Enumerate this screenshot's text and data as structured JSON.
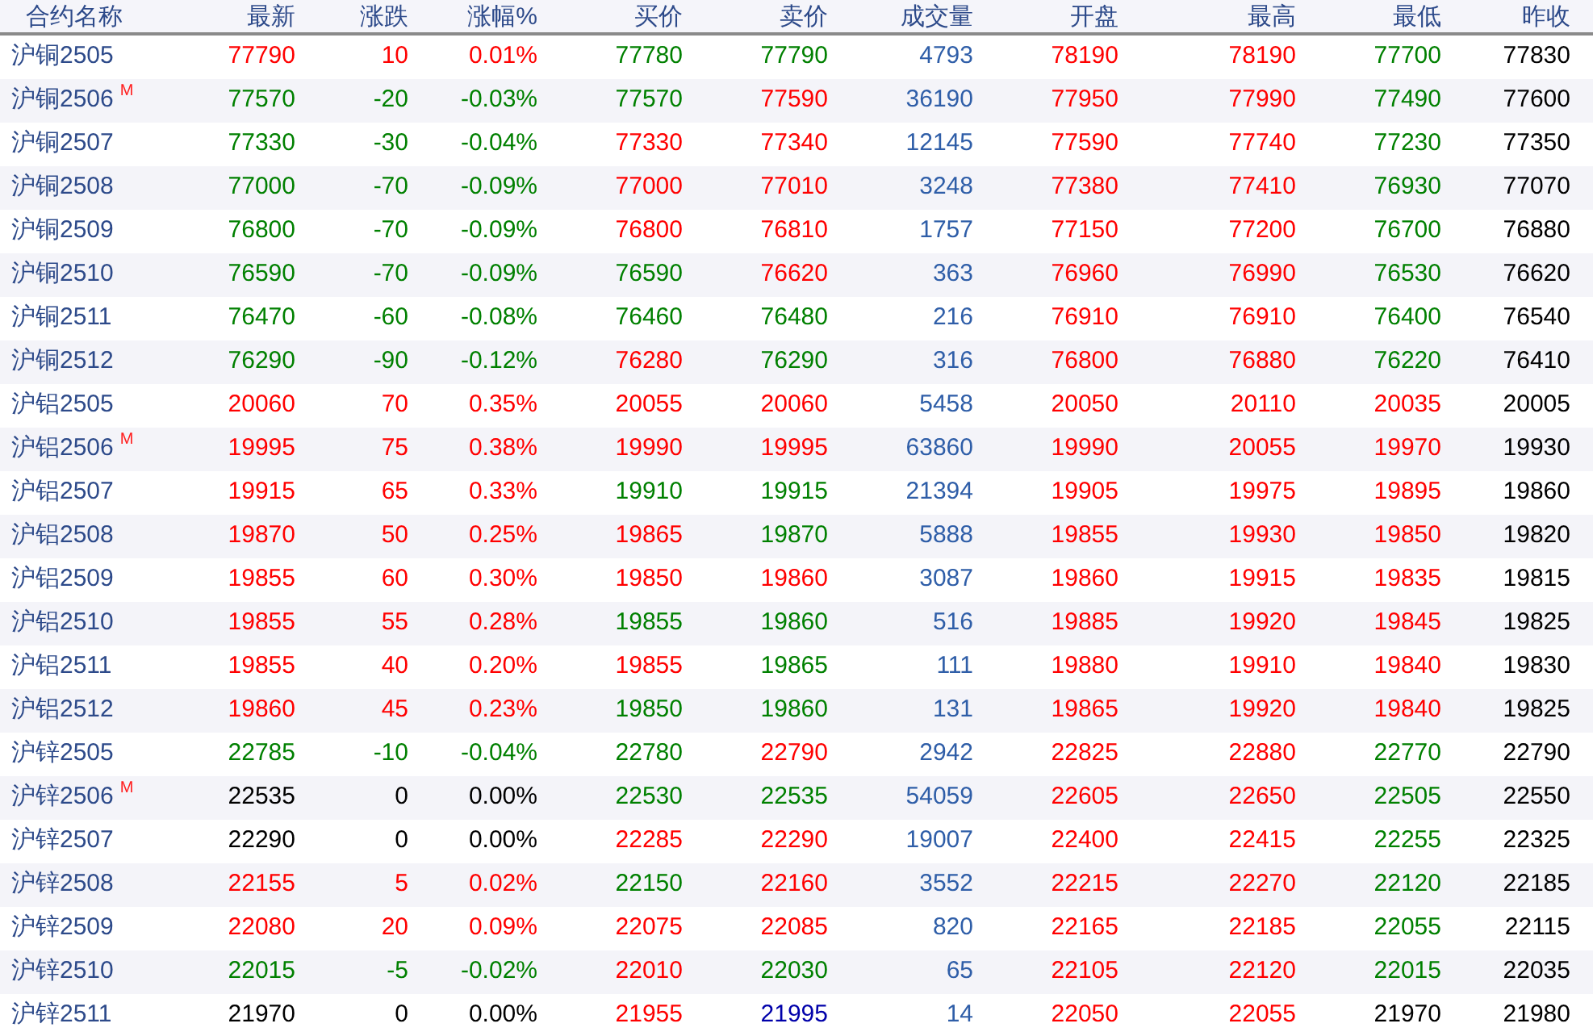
{
  "columns": [
    "合约名称",
    "最新",
    "涨跌",
    "涨幅%",
    "买价",
    "卖价",
    "成交量",
    "开盘",
    "最高",
    "最低",
    "昨收"
  ],
  "rows": [
    {
      "name": "沪铜2505",
      "cells": [
        {
          "text": "77790",
          "color": "#ff0000"
        },
        {
          "text": "10",
          "color": "#ff0000"
        },
        {
          "text": "0.01%",
          "color": "#ff0000"
        },
        {
          "text": "77780",
          "color": "#008000"
        },
        {
          "text": "77790",
          "color": "#008000"
        },
        {
          "text": "4793",
          "color": "#2f5ea8"
        },
        {
          "text": "78190",
          "color": "#ff0000"
        },
        {
          "text": "78190",
          "color": "#ff0000"
        },
        {
          "text": "77700",
          "color": "#008000"
        },
        {
          "text": "77830",
          "color": "#000000"
        }
      ]
    },
    {
      "name": "沪铜2506",
      "badge": "M",
      "cells": [
        {
          "text": "77570",
          "color": "#008000"
        },
        {
          "text": "-20",
          "color": "#008000"
        },
        {
          "text": "-0.03%",
          "color": "#008000"
        },
        {
          "text": "77570",
          "color": "#008000"
        },
        {
          "text": "77590",
          "color": "#ff0000"
        },
        {
          "text": "36190",
          "color": "#2f5ea8"
        },
        {
          "text": "77950",
          "color": "#ff0000"
        },
        {
          "text": "77990",
          "color": "#ff0000"
        },
        {
          "text": "77490",
          "color": "#008000"
        },
        {
          "text": "77600",
          "color": "#000000"
        }
      ]
    },
    {
      "name": "沪铜2507",
      "cells": [
        {
          "text": "77330",
          "color": "#008000"
        },
        {
          "text": "-30",
          "color": "#008000"
        },
        {
          "text": "-0.04%",
          "color": "#008000"
        },
        {
          "text": "77330",
          "color": "#ff0000"
        },
        {
          "text": "77340",
          "color": "#ff0000"
        },
        {
          "text": "12145",
          "color": "#2f5ea8"
        },
        {
          "text": "77590",
          "color": "#ff0000"
        },
        {
          "text": "77740",
          "color": "#ff0000"
        },
        {
          "text": "77230",
          "color": "#008000"
        },
        {
          "text": "77350",
          "color": "#000000"
        }
      ]
    },
    {
      "name": "沪铜2508",
      "cells": [
        {
          "text": "77000",
          "color": "#008000"
        },
        {
          "text": "-70",
          "color": "#008000"
        },
        {
          "text": "-0.09%",
          "color": "#008000"
        },
        {
          "text": "77000",
          "color": "#ff0000"
        },
        {
          "text": "77010",
          "color": "#ff0000"
        },
        {
          "text": "3248",
          "color": "#2f5ea8"
        },
        {
          "text": "77380",
          "color": "#ff0000"
        },
        {
          "text": "77410",
          "color": "#ff0000"
        },
        {
          "text": "76930",
          "color": "#008000"
        },
        {
          "text": "77070",
          "color": "#000000"
        }
      ]
    },
    {
      "name": "沪铜2509",
      "cells": [
        {
          "text": "76800",
          "color": "#008000"
        },
        {
          "text": "-70",
          "color": "#008000"
        },
        {
          "text": "-0.09%",
          "color": "#008000"
        },
        {
          "text": "76800",
          "color": "#ff0000"
        },
        {
          "text": "76810",
          "color": "#ff0000"
        },
        {
          "text": "1757",
          "color": "#2f5ea8"
        },
        {
          "text": "77150",
          "color": "#ff0000"
        },
        {
          "text": "77200",
          "color": "#ff0000"
        },
        {
          "text": "76700",
          "color": "#008000"
        },
        {
          "text": "76880",
          "color": "#000000"
        }
      ]
    },
    {
      "name": "沪铜2510",
      "cells": [
        {
          "text": "76590",
          "color": "#008000"
        },
        {
          "text": "-70",
          "color": "#008000"
        },
        {
          "text": "-0.09%",
          "color": "#008000"
        },
        {
          "text": "76590",
          "color": "#008000"
        },
        {
          "text": "76620",
          "color": "#ff0000"
        },
        {
          "text": "363",
          "color": "#2f5ea8"
        },
        {
          "text": "76960",
          "color": "#ff0000"
        },
        {
          "text": "76990",
          "color": "#ff0000"
        },
        {
          "text": "76530",
          "color": "#008000"
        },
        {
          "text": "76620",
          "color": "#000000"
        }
      ]
    },
    {
      "name": "沪铜2511",
      "cells": [
        {
          "text": "76470",
          "color": "#008000"
        },
        {
          "text": "-60",
          "color": "#008000"
        },
        {
          "text": "-0.08%",
          "color": "#008000"
        },
        {
          "text": "76460",
          "color": "#008000"
        },
        {
          "text": "76480",
          "color": "#008000"
        },
        {
          "text": "216",
          "color": "#2f5ea8"
        },
        {
          "text": "76910",
          "color": "#ff0000"
        },
        {
          "text": "76910",
          "color": "#ff0000"
        },
        {
          "text": "76400",
          "color": "#008000"
        },
        {
          "text": "76540",
          "color": "#000000"
        }
      ]
    },
    {
      "name": "沪铜2512",
      "cells": [
        {
          "text": "76290",
          "color": "#008000"
        },
        {
          "text": "-90",
          "color": "#008000"
        },
        {
          "text": "-0.12%",
          "color": "#008000"
        },
        {
          "text": "76280",
          "color": "#ff0000"
        },
        {
          "text": "76290",
          "color": "#008000"
        },
        {
          "text": "316",
          "color": "#2f5ea8"
        },
        {
          "text": "76800",
          "color": "#ff0000"
        },
        {
          "text": "76880",
          "color": "#ff0000"
        },
        {
          "text": "76220",
          "color": "#008000"
        },
        {
          "text": "76410",
          "color": "#000000"
        }
      ]
    },
    {
      "name": "沪铝2505",
      "cells": [
        {
          "text": "20060",
          "color": "#ff0000"
        },
        {
          "text": "70",
          "color": "#ff0000"
        },
        {
          "text": "0.35%",
          "color": "#ff0000"
        },
        {
          "text": "20055",
          "color": "#ff0000"
        },
        {
          "text": "20060",
          "color": "#ff0000"
        },
        {
          "text": "5458",
          "color": "#2f5ea8"
        },
        {
          "text": "20050",
          "color": "#ff0000"
        },
        {
          "text": "20110",
          "color": "#ff0000"
        },
        {
          "text": "20035",
          "color": "#ff0000"
        },
        {
          "text": "20005",
          "color": "#000000"
        }
      ]
    },
    {
      "name": "沪铝2506",
      "badge": "M",
      "cells": [
        {
          "text": "19995",
          "color": "#ff0000"
        },
        {
          "text": "75",
          "color": "#ff0000"
        },
        {
          "text": "0.38%",
          "color": "#ff0000"
        },
        {
          "text": "19990",
          "color": "#ff0000"
        },
        {
          "text": "19995",
          "color": "#ff0000"
        },
        {
          "text": "63860",
          "color": "#2f5ea8"
        },
        {
          "text": "19990",
          "color": "#ff0000"
        },
        {
          "text": "20055",
          "color": "#ff0000"
        },
        {
          "text": "19970",
          "color": "#ff0000"
        },
        {
          "text": "19930",
          "color": "#000000"
        }
      ]
    },
    {
      "name": "沪铝2507",
      "cells": [
        {
          "text": "19915",
          "color": "#ff0000"
        },
        {
          "text": "65",
          "color": "#ff0000"
        },
        {
          "text": "0.33%",
          "color": "#ff0000"
        },
        {
          "text": "19910",
          "color": "#008000"
        },
        {
          "text": "19915",
          "color": "#008000"
        },
        {
          "text": "21394",
          "color": "#2f5ea8"
        },
        {
          "text": "19905",
          "color": "#ff0000"
        },
        {
          "text": "19975",
          "color": "#ff0000"
        },
        {
          "text": "19895",
          "color": "#ff0000"
        },
        {
          "text": "19860",
          "color": "#000000"
        }
      ]
    },
    {
      "name": "沪铝2508",
      "cells": [
        {
          "text": "19870",
          "color": "#ff0000"
        },
        {
          "text": "50",
          "color": "#ff0000"
        },
        {
          "text": "0.25%",
          "color": "#ff0000"
        },
        {
          "text": "19865",
          "color": "#ff0000"
        },
        {
          "text": "19870",
          "color": "#008000"
        },
        {
          "text": "5888",
          "color": "#2f5ea8"
        },
        {
          "text": "19855",
          "color": "#ff0000"
        },
        {
          "text": "19930",
          "color": "#ff0000"
        },
        {
          "text": "19850",
          "color": "#ff0000"
        },
        {
          "text": "19820",
          "color": "#000000"
        }
      ]
    },
    {
      "name": "沪铝2509",
      "cells": [
        {
          "text": "19855",
          "color": "#ff0000"
        },
        {
          "text": "60",
          "color": "#ff0000"
        },
        {
          "text": "0.30%",
          "color": "#ff0000"
        },
        {
          "text": "19850",
          "color": "#ff0000"
        },
        {
          "text": "19860",
          "color": "#ff0000"
        },
        {
          "text": "3087",
          "color": "#2f5ea8"
        },
        {
          "text": "19860",
          "color": "#ff0000"
        },
        {
          "text": "19915",
          "color": "#ff0000"
        },
        {
          "text": "19835",
          "color": "#ff0000"
        },
        {
          "text": "19815",
          "color": "#000000"
        }
      ]
    },
    {
      "name": "沪铝2510",
      "cells": [
        {
          "text": "19855",
          "color": "#ff0000"
        },
        {
          "text": "55",
          "color": "#ff0000"
        },
        {
          "text": "0.28%",
          "color": "#ff0000"
        },
        {
          "text": "19855",
          "color": "#008000"
        },
        {
          "text": "19860",
          "color": "#008000"
        },
        {
          "text": "516",
          "color": "#2f5ea8"
        },
        {
          "text": "19885",
          "color": "#ff0000"
        },
        {
          "text": "19920",
          "color": "#ff0000"
        },
        {
          "text": "19845",
          "color": "#ff0000"
        },
        {
          "text": "19825",
          "color": "#000000"
        }
      ]
    },
    {
      "name": "沪铝2511",
      "cells": [
        {
          "text": "19855",
          "color": "#ff0000"
        },
        {
          "text": "40",
          "color": "#ff0000"
        },
        {
          "text": "0.20%",
          "color": "#ff0000"
        },
        {
          "text": "19855",
          "color": "#ff0000"
        },
        {
          "text": "19865",
          "color": "#008000"
        },
        {
          "text": "111",
          "color": "#2f5ea8"
        },
        {
          "text": "19880",
          "color": "#ff0000"
        },
        {
          "text": "19910",
          "color": "#ff0000"
        },
        {
          "text": "19840",
          "color": "#ff0000"
        },
        {
          "text": "19830",
          "color": "#000000"
        }
      ]
    },
    {
      "name": "沪铝2512",
      "cells": [
        {
          "text": "19860",
          "color": "#ff0000"
        },
        {
          "text": "45",
          "color": "#ff0000"
        },
        {
          "text": "0.23%",
          "color": "#ff0000"
        },
        {
          "text": "19850",
          "color": "#008000"
        },
        {
          "text": "19860",
          "color": "#008000"
        },
        {
          "text": "131",
          "color": "#2f5ea8"
        },
        {
          "text": "19865",
          "color": "#ff0000"
        },
        {
          "text": "19920",
          "color": "#ff0000"
        },
        {
          "text": "19840",
          "color": "#ff0000"
        },
        {
          "text": "19825",
          "color": "#000000"
        }
      ]
    },
    {
      "name": "沪锌2505",
      "cells": [
        {
          "text": "22785",
          "color": "#008000"
        },
        {
          "text": "-10",
          "color": "#008000"
        },
        {
          "text": "-0.04%",
          "color": "#008000"
        },
        {
          "text": "22780",
          "color": "#008000"
        },
        {
          "text": "22790",
          "color": "#ff0000"
        },
        {
          "text": "2942",
          "color": "#2f5ea8"
        },
        {
          "text": "22825",
          "color": "#ff0000"
        },
        {
          "text": "22880",
          "color": "#ff0000"
        },
        {
          "text": "22770",
          "color": "#008000"
        },
        {
          "text": "22790",
          "color": "#000000"
        }
      ]
    },
    {
      "name": "沪锌2506",
      "badge": "M",
      "cells": [
        {
          "text": "22535",
          "color": "#000000"
        },
        {
          "text": "0",
          "color": "#000000"
        },
        {
          "text": "0.00%",
          "color": "#000000"
        },
        {
          "text": "22530",
          "color": "#008000"
        },
        {
          "text": "22535",
          "color": "#008000"
        },
        {
          "text": "54059",
          "color": "#2f5ea8"
        },
        {
          "text": "22605",
          "color": "#ff0000"
        },
        {
          "text": "22650",
          "color": "#ff0000"
        },
        {
          "text": "22505",
          "color": "#008000"
        },
        {
          "text": "22550",
          "color": "#000000"
        }
      ]
    },
    {
      "name": "沪锌2507",
      "cells": [
        {
          "text": "22290",
          "color": "#000000"
        },
        {
          "text": "0",
          "color": "#000000"
        },
        {
          "text": "0.00%",
          "color": "#000000"
        },
        {
          "text": "22285",
          "color": "#ff0000"
        },
        {
          "text": "22290",
          "color": "#ff0000"
        },
        {
          "text": "19007",
          "color": "#2f5ea8"
        },
        {
          "text": "22400",
          "color": "#ff0000"
        },
        {
          "text": "22415",
          "color": "#ff0000"
        },
        {
          "text": "22255",
          "color": "#008000"
        },
        {
          "text": "22325",
          "color": "#000000"
        }
      ]
    },
    {
      "name": "沪锌2508",
      "cells": [
        {
          "text": "22155",
          "color": "#ff0000"
        },
        {
          "text": "5",
          "color": "#ff0000"
        },
        {
          "text": "0.02%",
          "color": "#ff0000"
        },
        {
          "text": "22150",
          "color": "#008000"
        },
        {
          "text": "22160",
          "color": "#ff0000"
        },
        {
          "text": "3552",
          "color": "#2f5ea8"
        },
        {
          "text": "22215",
          "color": "#ff0000"
        },
        {
          "text": "22270",
          "color": "#ff0000"
        },
        {
          "text": "22120",
          "color": "#008000"
        },
        {
          "text": "22185",
          "color": "#000000"
        }
      ]
    },
    {
      "name": "沪锌2509",
      "cells": [
        {
          "text": "22080",
          "color": "#ff0000"
        },
        {
          "text": "20",
          "color": "#ff0000"
        },
        {
          "text": "0.09%",
          "color": "#ff0000"
        },
        {
          "text": "22075",
          "color": "#ff0000"
        },
        {
          "text": "22085",
          "color": "#ff0000"
        },
        {
          "text": "820",
          "color": "#2f5ea8"
        },
        {
          "text": "22165",
          "color": "#ff0000"
        },
        {
          "text": "22185",
          "color": "#ff0000"
        },
        {
          "text": "22055",
          "color": "#008000"
        },
        {
          "text": "22115",
          "color": "#000000"
        }
      ]
    },
    {
      "name": "沪锌2510",
      "cells": [
        {
          "text": "22015",
          "color": "#008000"
        },
        {
          "text": "-5",
          "color": "#008000"
        },
        {
          "text": "-0.02%",
          "color": "#008000"
        },
        {
          "text": "22010",
          "color": "#ff0000"
        },
        {
          "text": "22030",
          "color": "#008000"
        },
        {
          "text": "65",
          "color": "#2f5ea8"
        },
        {
          "text": "22105",
          "color": "#ff0000"
        },
        {
          "text": "22120",
          "color": "#ff0000"
        },
        {
          "text": "22015",
          "color": "#008000"
        },
        {
          "text": "22035",
          "color": "#000000"
        }
      ]
    },
    {
      "name": "沪锌2511",
      "cells": [
        {
          "text": "21970",
          "color": "#000000"
        },
        {
          "text": "0",
          "color": "#000000"
        },
        {
          "text": "0.00%",
          "color": "#000000"
        },
        {
          "text": "21955",
          "color": "#ff0000"
        },
        {
          "text": "21995",
          "color": "#0000aa"
        },
        {
          "text": "14",
          "color": "#2f5ea8"
        },
        {
          "text": "22050",
          "color": "#ff0000"
        },
        {
          "text": "22055",
          "color": "#ff0000"
        },
        {
          "text": "21970",
          "color": "#000000"
        },
        {
          "text": "21980",
          "color": "#000000"
        }
      ]
    }
  ]
}
